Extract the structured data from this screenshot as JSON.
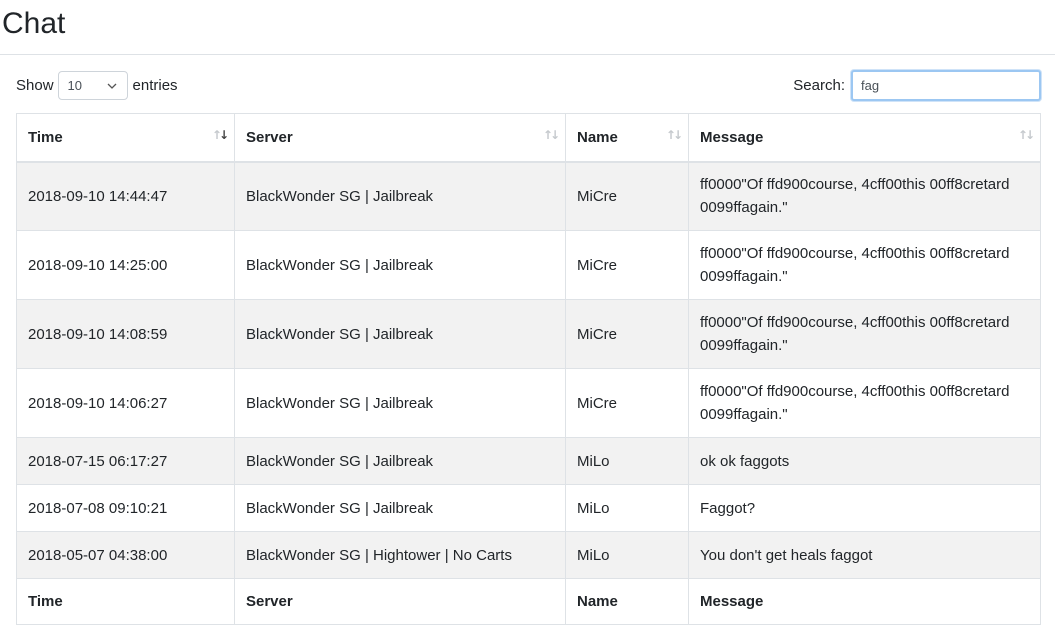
{
  "page": {
    "title": "Chat"
  },
  "length": {
    "show_label": "Show",
    "entries_label": "entries",
    "selected": "10"
  },
  "search": {
    "label": "Search:",
    "value": "fag"
  },
  "table": {
    "columns": [
      "Time",
      "Server",
      "Name",
      "Message"
    ],
    "rows": [
      {
        "time": "2018-09-10 14:44:47",
        "server": "BlackWonder SG | Jailbreak",
        "name": "MiCre",
        "message": "ff0000\"Of ffd900course, 4cff00this 00ff8cretard 0099ffagain.\""
      },
      {
        "time": "2018-09-10 14:25:00",
        "server": "BlackWonder SG | Jailbreak",
        "name": "MiCre",
        "message": "ff0000\"Of ffd900course, 4cff00this 00ff8cretard 0099ffagain.\""
      },
      {
        "time": "2018-09-10 14:08:59",
        "server": "BlackWonder SG | Jailbreak",
        "name": "MiCre",
        "message": "ff0000\"Of ffd900course, 4cff00this 00ff8cretard 0099ffagain.\""
      },
      {
        "time": "2018-09-10 14:06:27",
        "server": "BlackWonder SG | Jailbreak",
        "name": "MiCre",
        "message": "ff0000\"Of ffd900course, 4cff00this 00ff8cretard 0099ffagain.\""
      },
      {
        "time": "2018-07-15 06:17:27",
        "server": "BlackWonder SG | Jailbreak",
        "name": "MiLo",
        "message": "ok ok faggots"
      },
      {
        "time": "2018-07-08 09:10:21",
        "server": "BlackWonder SG | Jailbreak",
        "name": "MiLo",
        "message": "Faggot?"
      },
      {
        "time": "2018-05-07 04:38:00",
        "server": "BlackWonder SG | Hightower | No Carts",
        "name": "MiLo",
        "message": "You don't get heals faggot"
      }
    ]
  },
  "icons": {
    "sort": "sort-arrows-icon",
    "select": "chevron-down-icon"
  },
  "colors": {
    "row_stripe": "#f2f2f2",
    "border": "#dee2e6",
    "focus": "#9cc7f2"
  }
}
